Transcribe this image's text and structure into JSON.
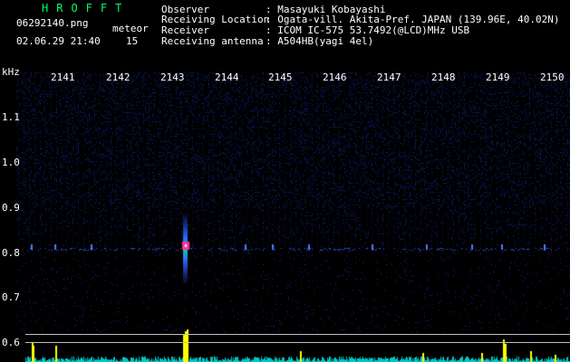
{
  "header": {
    "brand": "HROFFT",
    "filename": "06292140.png",
    "datetime": "02.06.29 21:40",
    "meteor_label": "meteor",
    "meteor_count": "15"
  },
  "info": {
    "rows": [
      {
        "label": "Observer",
        "value": ": Masayuki Kobayashi"
      },
      {
        "label": "Receiving Location",
        "value": ": Ogata-vill. Akita-Pref. JAPAN (139.96E, 40.02N)"
      },
      {
        "label": "Receiver",
        "value": ": ICOM IC-575 53.7492(@LCD)MHz USB"
      },
      {
        "label": "Receiving antenna",
        "value": ": A504HB(yagi 4el)"
      }
    ]
  },
  "axis": {
    "unit": "kHz",
    "time_ticks": [
      "2141",
      "2142",
      "2143",
      "2144",
      "2145",
      "2146",
      "2147",
      "2148",
      "2149",
      "2150"
    ],
    "freq_ticks": [
      "1.1",
      "1.0",
      "0.9",
      "0.8",
      "0.7",
      "0.6"
    ]
  },
  "colors": {
    "bg": "#000000",
    "brand": "#00ff66",
    "noise": "#1a2b9a",
    "signal": "#3a5bff",
    "meteor_core": "#ff3399",
    "echo_bar": "#ffff00",
    "echo_low": "#00c8c8"
  }
}
